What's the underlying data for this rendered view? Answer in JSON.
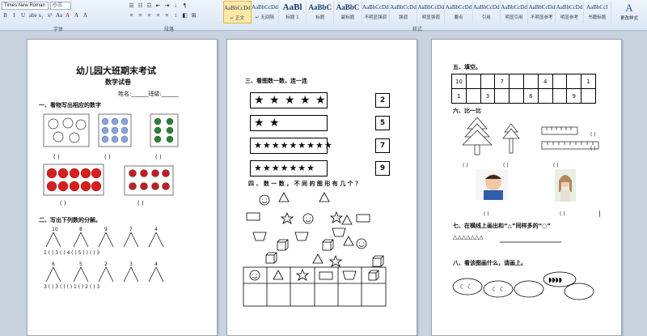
{
  "ribbon": {
    "font_name": "Times New Roman",
    "font_size": "小三",
    "group_font": "字体",
    "group_paragraph": "段落",
    "group_styles": "样式",
    "change_styles": "更改样式",
    "format_buttons": [
      "B",
      "I",
      "U",
      "abe",
      "x₂",
      "x²",
      "Aa",
      "A",
      "A",
      "A"
    ],
    "para_buttons": [
      "≡",
      "≡",
      "≡",
      "≡",
      "≡",
      "↕",
      "◧",
      "⊞"
    ],
    "styles": [
      {
        "preview": "AaBbCcDd",
        "name": "↵ 正文"
      },
      {
        "preview": "AaBbCcDd",
        "name": "↵ 无间隔"
      },
      {
        "preview": "AaBl",
        "name": "标题 1"
      },
      {
        "preview": "AaBbC",
        "name": "标题"
      },
      {
        "preview": "AaBbC",
        "name": "副标题"
      },
      {
        "preview": "AaBbCcDd",
        "name": "不明显强调"
      },
      {
        "preview": "AaBbCcDd",
        "name": "强调"
      },
      {
        "preview": "AaBbCcDd",
        "name": "明显强调"
      },
      {
        "preview": "AaBbCcDd",
        "name": "要点"
      },
      {
        "preview": "AaBbCcDd",
        "name": "引用"
      },
      {
        "preview": "AaBbCcDd",
        "name": "明显引用"
      },
      {
        "preview": "AaBbCcDd",
        "name": "不明显参考"
      },
      {
        "preview": "AaBbCcDd",
        "name": "明显参考"
      },
      {
        "preview": "AaBbCcI",
        "name": "书籍标题"
      }
    ]
  },
  "page1": {
    "title": "幼儿园大班期末考试",
    "subtitle": "数学试卷",
    "name_line": "姓名:______班级:______",
    "q1": "一、看物写出相应的数字",
    "paren": "(      )",
    "q2": "二、写出下列数的分解。",
    "top_nums_row1": [
      "10",
      "8",
      "9",
      "7",
      "4"
    ],
    "bottom_row1": "1 (   ) 3 (   ) 4 (   ) 5 (   ) (   ) 3",
    "top_nums_row2": [
      "6",
      "5",
      "2",
      "3",
      "4"
    ],
    "bottom_row2": "3 (   ) 3 (   ) (   ) 1 (   ) 2 (   ) 3"
  },
  "page2": {
    "q3": "三、看图数一数，连一连",
    "star_rows": [
      "★ ★ ★ ★ ★",
      "★ ★",
      "★★★★★★★★★",
      "★★★★★★★"
    ],
    "numbers": [
      "2",
      "5",
      "7",
      "9"
    ],
    "q4": "四 、 数 一 数 ， 不 同 的 图 形 有 几 个 ？"
  },
  "page3": {
    "q5": "五、填空。",
    "row1": [
      "10",
      "",
      "",
      "7",
      "",
      "",
      "4",
      "",
      "",
      "1"
    ],
    "row2": [
      "1",
      "",
      "3",
      "",
      "",
      "6",
      "",
      "",
      "9",
      ""
    ],
    "q6": "六、比一比",
    "paren": "(   )",
    "q7": "七、在横线上画出和“△”同样多的“○”",
    "triangles": "△△△△△△△",
    "q8": "八、看该图画什么，请画上。"
  }
}
